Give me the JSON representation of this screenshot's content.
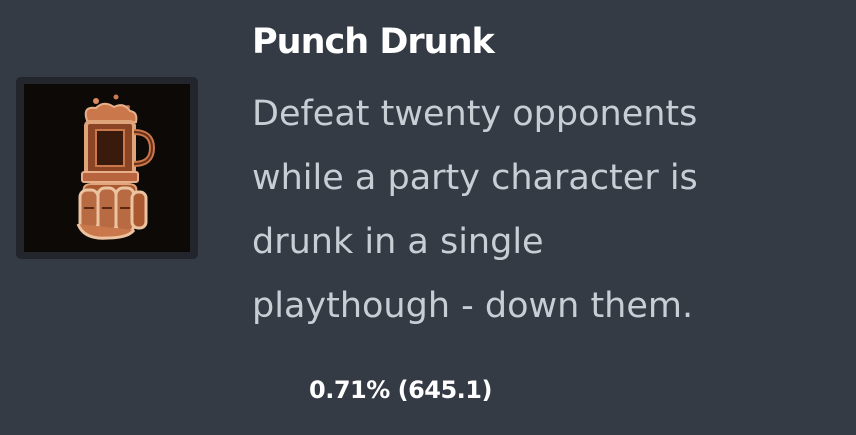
{
  "achievement": {
    "title": "Punch Drunk",
    "description_lines": [
      "Defeat twenty opponents",
      "while a party character is",
      "drunk in a single",
      "playthough - down them."
    ],
    "stats": "0.71% (645.1)",
    "icon": "beer-mug-fist-icon"
  },
  "colors": {
    "background": "#343b45",
    "icon_frame": "#22262c",
    "icon_background": "#0c0907",
    "icon_copper": "#b8643f",
    "title": "#ffffff",
    "description": "#c9ced5"
  }
}
